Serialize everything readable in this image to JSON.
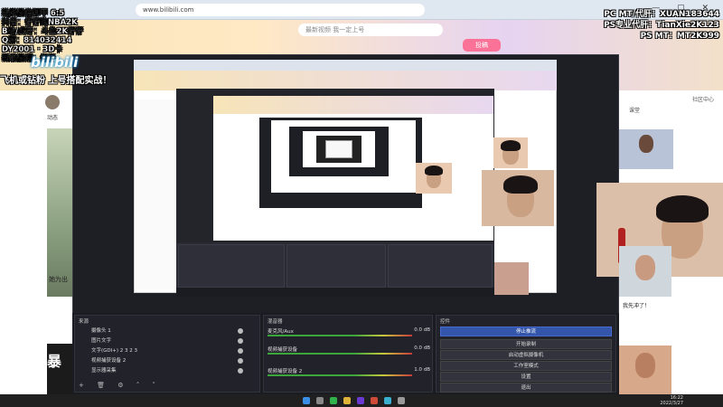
{
  "browser": {
    "url": "www.bilibili.com"
  },
  "site": {
    "logo": "bilibili",
    "search_placeholder": "最新视频 我一定上号",
    "upload_label": "投稿"
  },
  "overlay_left": {
    "lines": [
      "粘粉微信卸甲 6:5",
      "抖音：仔仔的NBA2K",
      "B站/虎牙：斗鱼2K仔仔",
      "Q群：814032414",
      "DY2001 · 3D卡",
      "新浪微博：仔仔"
    ],
    "promo": "飞机或钻粉 上号搭配实战！"
  },
  "overlay_right": {
    "lines": [
      "PC MT/代肝：XUAN183644",
      "PS专业代肝：TianXie2K123",
      "PS MT：MT2K999"
    ]
  },
  "left_side": {
    "dyn_label": "动态",
    "caption": "她为出"
  },
  "right_side": {
    "menu": [
      "社区中心",
      "课堂",
      "粉丝团",
      "稿件"
    ]
  },
  "obs": {
    "docks": {
      "scenes": {
        "title": "来源",
        "items": [
          "摄像头 1",
          "图片文字",
          "文字(GDI+) 2 3 2 3",
          "视频捕获设备 2",
          "显示器采集"
        ]
      },
      "mixer": {
        "title": "混音器",
        "items": [
          {
            "name": "麦克风/Aux",
            "db": "0.0 dB"
          },
          {
            "name": "视频捕获设备",
            "db": "0.0 dB"
          },
          {
            "name": "视频捕获设备 2",
            "db": "1.0 dB"
          }
        ]
      },
      "controls": {
        "title": "控件",
        "buttons": [
          "停止推流",
          "开始录制",
          "启动虚拟摄像机",
          "工作室模式",
          "设置",
          "退出"
        ]
      }
    }
  },
  "cam_caption": "我先冲了！",
  "taskbar": {
    "time": "16:22",
    "date": "2022/3/27"
  }
}
